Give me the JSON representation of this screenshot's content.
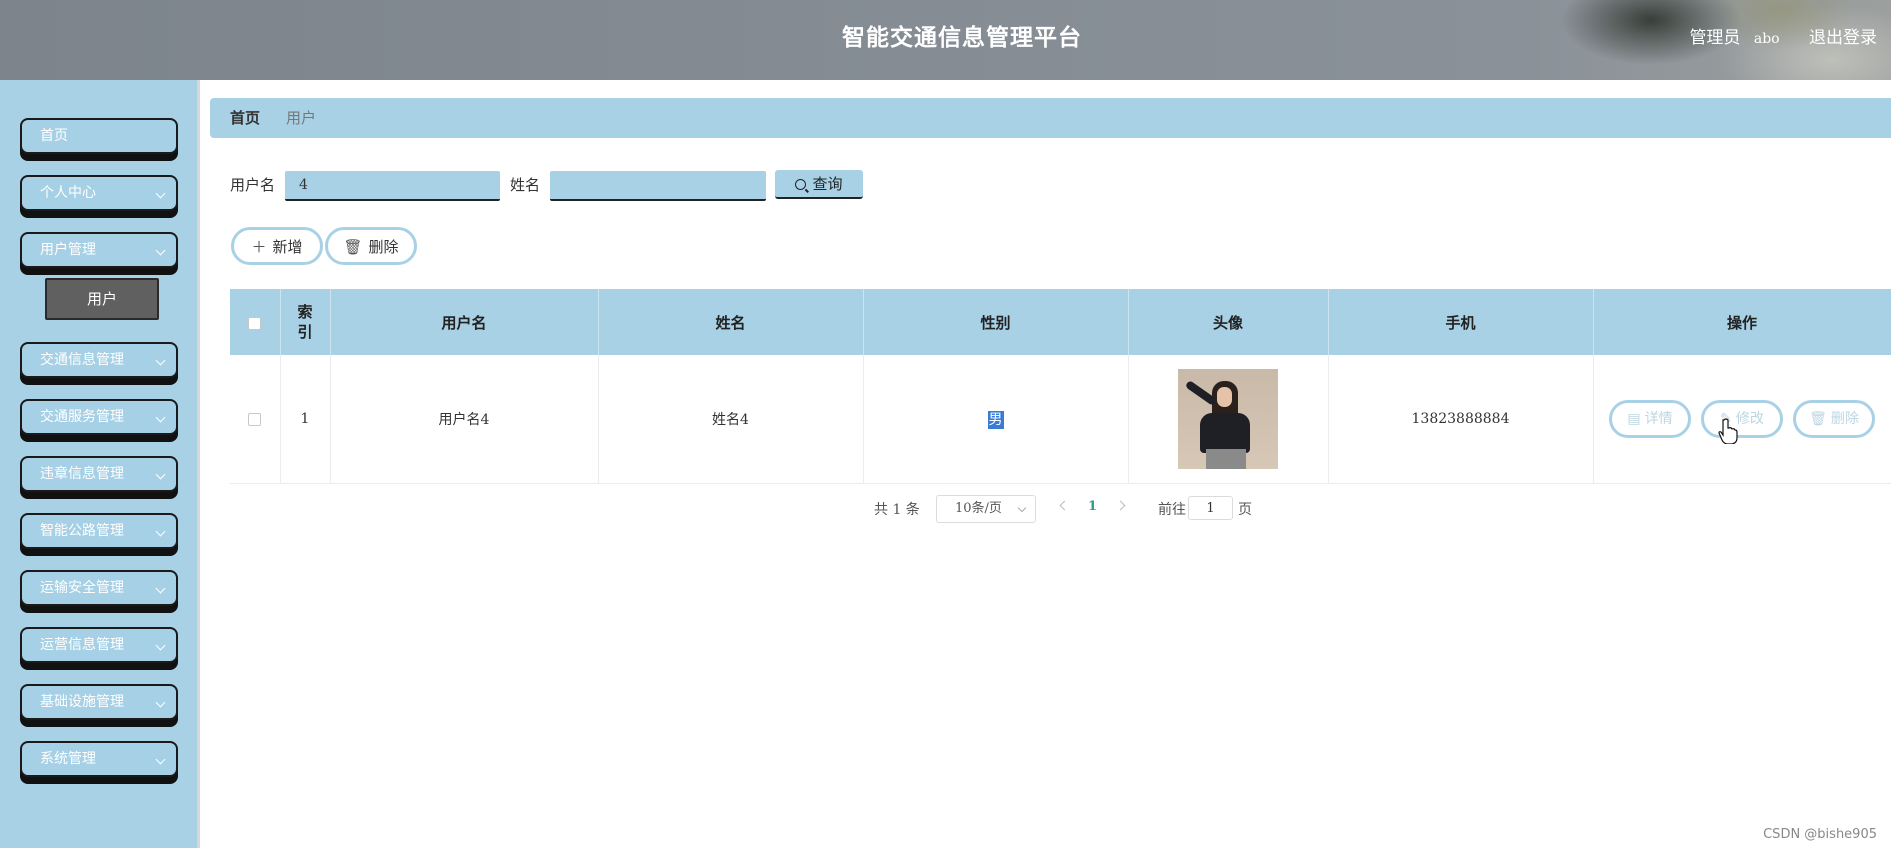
{
  "header": {
    "title": "智能交通信息管理平台",
    "role": "管理员",
    "username": "abo",
    "logout_label": "退出登录"
  },
  "sidebar": {
    "items": [
      {
        "label": "首页"
      },
      {
        "label": "个人中心"
      },
      {
        "label": "用户管理"
      },
      {
        "label": "交通信息管理"
      },
      {
        "label": "交通服务管理"
      },
      {
        "label": "违章信息管理"
      },
      {
        "label": "智能公路管理"
      },
      {
        "label": "运输安全管理"
      },
      {
        "label": "运营信息管理"
      },
      {
        "label": "基础设施管理"
      },
      {
        "label": "系统管理"
      }
    ],
    "sub_item": "用户"
  },
  "breadcrumb": {
    "home": "首页",
    "current": "用户"
  },
  "search": {
    "username_label": "用户名",
    "username_value": "4",
    "name_label": "姓名",
    "name_value": "",
    "query_label": "查询"
  },
  "actions": {
    "add_label": "新增",
    "delete_label": "删除"
  },
  "table": {
    "columns": [
      "索引",
      "用户名",
      "姓名",
      "性别",
      "头像",
      "手机",
      "操作"
    ],
    "rows": [
      {
        "index": "1",
        "username": "用户名4",
        "name": "姓名4",
        "gender": "男",
        "phone": "13823888884"
      }
    ],
    "row_actions": {
      "detail": "详情",
      "edit": "修改",
      "delete": "删除"
    }
  },
  "pagination": {
    "total_text": "共 1 条",
    "page_size": "10条/页",
    "current_page": "1",
    "goto_label": "前往",
    "goto_value": "1",
    "page_unit": "页"
  },
  "watermark": "CSDN @bishe905",
  "colors": {
    "accent": "#a8d1e6",
    "header_bg": "#868d95",
    "submenu_bg": "#606060"
  }
}
